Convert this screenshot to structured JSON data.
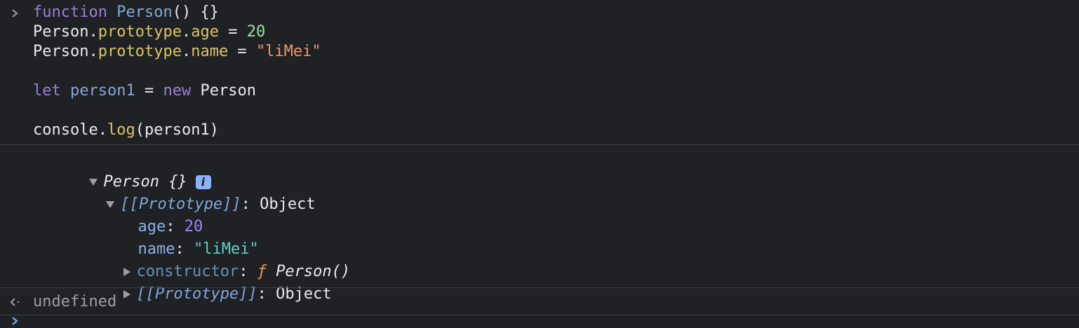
{
  "input": {
    "lines": [
      [
        {
          "t": "function",
          "c": "kw"
        },
        {
          "t": " ",
          "c": "plain"
        },
        {
          "t": "Person",
          "c": "id"
        },
        {
          "t": "() {}",
          "c": "punc"
        }
      ],
      [
        {
          "t": "Person",
          "c": "plain"
        },
        {
          "t": ".",
          "c": "punc"
        },
        {
          "t": "prototype",
          "c": "prop"
        },
        {
          "t": ".",
          "c": "punc"
        },
        {
          "t": "age",
          "c": "prop"
        },
        {
          "t": " = ",
          "c": "punc"
        },
        {
          "t": "20",
          "c": "num"
        }
      ],
      [
        {
          "t": "Person",
          "c": "plain"
        },
        {
          "t": ".",
          "c": "punc"
        },
        {
          "t": "prototype",
          "c": "prop"
        },
        {
          "t": ".",
          "c": "punc"
        },
        {
          "t": "name",
          "c": "prop"
        },
        {
          "t": " = ",
          "c": "punc"
        },
        {
          "t": "\"liMei\"",
          "c": "str"
        }
      ],
      [],
      [
        {
          "t": "let",
          "c": "kw"
        },
        {
          "t": " ",
          "c": "plain"
        },
        {
          "t": "person1",
          "c": "id"
        },
        {
          "t": " = ",
          "c": "punc"
        },
        {
          "t": "new",
          "c": "kw"
        },
        {
          "t": " ",
          "c": "plain"
        },
        {
          "t": "Person",
          "c": "plain"
        }
      ],
      [],
      [
        {
          "t": "console",
          "c": "plain"
        },
        {
          "t": ".",
          "c": "punc"
        },
        {
          "t": "log",
          "c": "prop"
        },
        {
          "t": "(person1)",
          "c": "punc"
        }
      ]
    ]
  },
  "output": {
    "root_label": "Person {}",
    "info_badge": "i",
    "prototype": {
      "key": "[[Prototype]]",
      "separator": ": ",
      "value": "Object"
    },
    "age": {
      "key": "age",
      "separator": ": ",
      "value": "20"
    },
    "name": {
      "key": "name",
      "separator": ": ",
      "value": "\"liMei\""
    },
    "constructor": {
      "key": "constructor",
      "separator": ": ",
      "glyph": "ƒ",
      "value": "Person()"
    },
    "inner_prototype": {
      "key": "[[Prototype]]",
      "separator": ": ",
      "value": "Object"
    }
  },
  "result": {
    "value": "undefined"
  },
  "colors": {
    "background": "#202124",
    "keyword": "#9a7fd5",
    "identifier": "#80a8da",
    "property": "#d9c56a",
    "number": "#9fe3a1",
    "string": "#f29766",
    "info_badge": "#8ab4f8"
  },
  "icons": {
    "prompt": "chevron-right-icon",
    "return": "return-arrow-icon",
    "expand": "triangle-down-icon",
    "collapse": "triangle-right-icon",
    "info": "info-icon"
  }
}
